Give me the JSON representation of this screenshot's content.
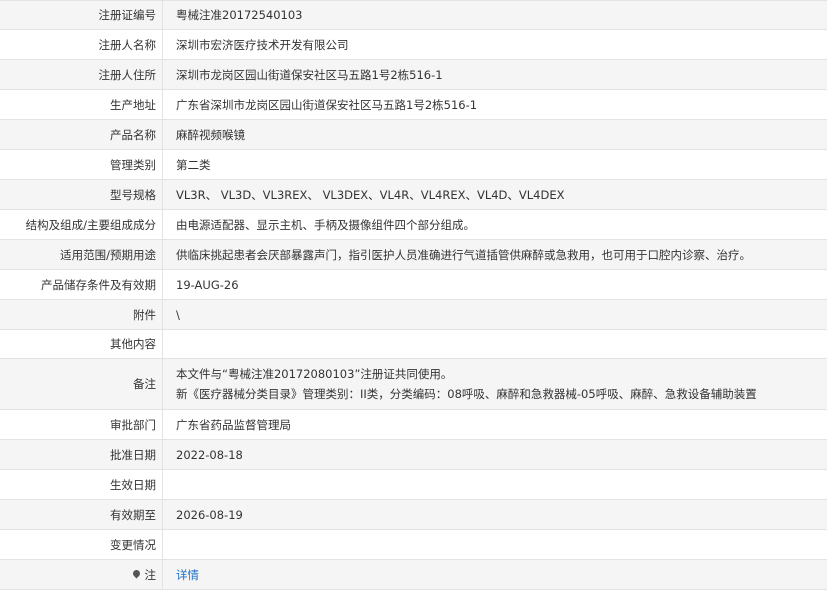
{
  "rows": [
    {
      "label": "注册证编号",
      "value": "粤械注准20172540103"
    },
    {
      "label": "注册人名称",
      "value": "深圳市宏济医疗技术开发有限公司"
    },
    {
      "label": "注册人住所",
      "value": "深圳市龙岗区园山街道保安社区马五路1号2栋516-1"
    },
    {
      "label": "生产地址",
      "value": "广东省深圳市龙岗区园山街道保安社区马五路1号2栋516-1"
    },
    {
      "label": "产品名称",
      "value": "麻醉视频喉镜"
    },
    {
      "label": "管理类别",
      "value": "第二类"
    },
    {
      "label": "型号规格",
      "value": "VL3R、 VL3D、VL3REX、 VL3DEX、VL4R、VL4REX、VL4D、VL4DEX"
    },
    {
      "label": "结构及组成/主要组成成分",
      "value": "由电源适配器、显示主机、手柄及摄像组件四个部分组成。"
    },
    {
      "label": "适用范围/预期用途",
      "value": "供临床挑起患者会厌部暴露声门，指引医护人员准确进行气道插管供麻醉或急救用，也可用于口腔内诊察、治疗。"
    },
    {
      "label": "产品储存条件及有效期",
      "value": "19-AUG-26"
    },
    {
      "label": "附件",
      "value": "\\"
    },
    {
      "label": "其他内容",
      "value": ""
    },
    {
      "label": "备注",
      "value_line1": "本文件与“粤械注准20172080103”注册证共同使用。",
      "value_line2": "新《医疗器械分类目录》管理类别：II类，分类编码：08呼吸、麻醉和急救器械-05呼吸、麻醉、急救设备辅助装置"
    },
    {
      "label": "审批部门",
      "value": "广东省药品监督管理局"
    },
    {
      "label": "批准日期",
      "value": "2022-08-18"
    },
    {
      "label": "生效日期",
      "value": ""
    },
    {
      "label": "有效期至",
      "value": "2026-08-19"
    },
    {
      "label": "变更情况",
      "value": ""
    },
    {
      "label": "注",
      "value": "详情",
      "icon": "map-pin-icon"
    }
  ]
}
